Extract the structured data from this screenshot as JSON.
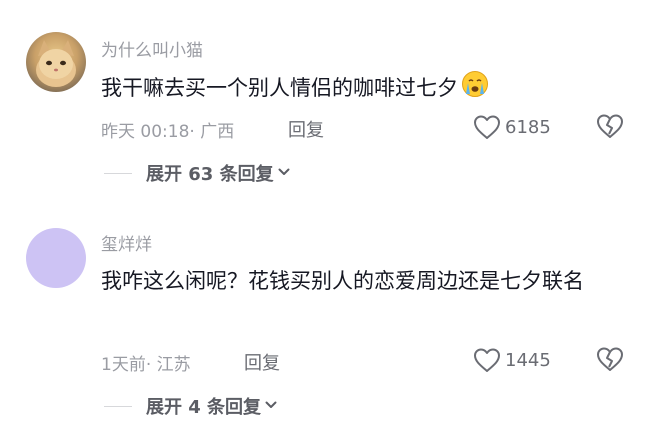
{
  "comments": [
    {
      "username": "为什么叫小猫",
      "content": "我干嘛去买一个别人情侣的咖啡过七夕",
      "emoji": "crying-face-icon",
      "time": "昨天 00:18",
      "location": "· 广西",
      "reply_label": "回复",
      "likes": "6185",
      "expand_label": "展开 63 条回复"
    },
    {
      "username": "玺烊烊",
      "content": "我咋这么闲呢？花钱买别人的恋爱周边还是七夕联名",
      "time": "1天前",
      "location": "· 江苏",
      "reply_label": "回复",
      "likes": "1445",
      "expand_label": "展开 4 条回复"
    }
  ],
  "colors": {
    "text_primary": "#161823",
    "text_secondary": "#9a9ca3",
    "action_gray": "#6a6c73",
    "avatar_lavender": "#cdc3f4"
  }
}
